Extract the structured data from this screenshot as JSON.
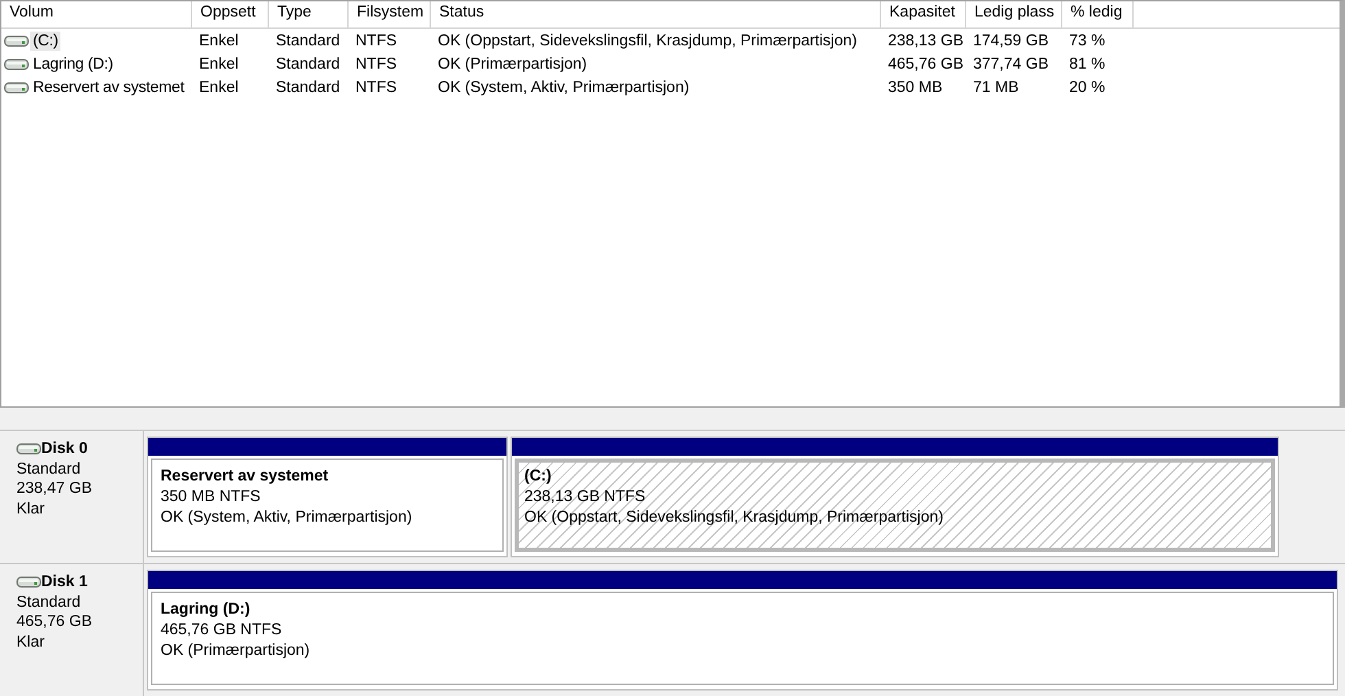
{
  "volume_table": {
    "columns": [
      "Volum",
      "Oppsett",
      "Type",
      "Filsystem",
      "Status",
      "Kapasitet",
      "Ledig plass",
      "% ledig"
    ],
    "rows": [
      {
        "selected": true,
        "cells": [
          "(C:)",
          "Enkel",
          "Standard",
          "NTFS",
          "OK (Oppstart, Sidevekslingsfil, Krasjdump, Primærpartisjon)",
          "238,13 GB",
          "174,59 GB",
          "73 %"
        ]
      },
      {
        "selected": false,
        "cells": [
          "Lagring (D:)",
          "Enkel",
          "Standard",
          "NTFS",
          "OK (Primærpartisjon)",
          "465,76 GB",
          "377,74 GB",
          "81 %"
        ]
      },
      {
        "selected": false,
        "cells": [
          "Reservert av systemet",
          "Enkel",
          "Standard",
          "NTFS",
          "OK (System, Aktiv, Primærpartisjon)",
          "350 MB",
          "71 MB",
          "20 %"
        ]
      }
    ]
  },
  "disks": [
    {
      "name": "Disk 0",
      "type": "Standard",
      "size": "238,47 GB",
      "state": "Klar",
      "partitions": [
        {
          "name": "Reservert av systemet",
          "size": "350 MB NTFS",
          "status": "OK (System, Aktiv, Primærpartisjon)",
          "selected": false
        },
        {
          "name": " (C:)",
          "size": "238,13 GB NTFS",
          "status": "OK (Oppstart, Sidevekslingsfil, Krasjdump, Primærpartisjon)",
          "selected": true
        }
      ]
    },
    {
      "name": "Disk 1",
      "type": "Standard",
      "size": "465,76 GB",
      "state": "Klar",
      "partitions": [
        {
          "name": "Lagring  (D:)",
          "size": "465,76 GB NTFS",
          "status": "OK (Primærpartisjon)",
          "selected": false
        }
      ]
    }
  ]
}
